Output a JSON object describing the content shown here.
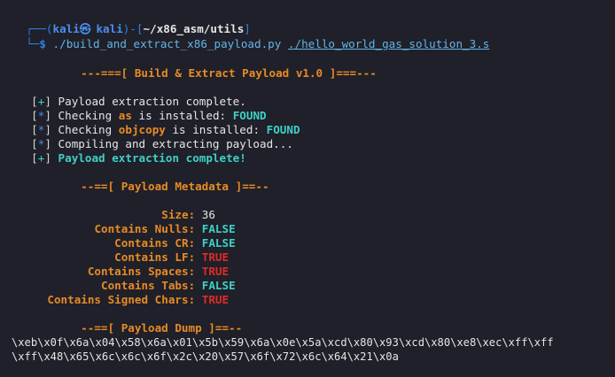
{
  "prompt": {
    "top_prefix": "┌──(",
    "user": "kali",
    "at": "㉿",
    "host": "kali",
    "mid": ")-[",
    "cwd": "~/x86_asm/utils",
    "end": "]",
    "bottom_prefix": "└─",
    "dollar": "$",
    "command": "./build_and_extract_x86_payload.py",
    "argument": "./hello_world_gas_solution_3.s"
  },
  "banner": {
    "left": "---===[",
    "title": "Build & Extract Payload v1.0",
    "right": "]===---"
  },
  "log": [
    {
      "mark": "+",
      "text": "Payload extraction complete."
    },
    {
      "mark": "*",
      "pre": "Checking ",
      "tool": "as",
      "mid": " is installed: ",
      "status": "FOUND"
    },
    {
      "mark": "*",
      "pre": "Checking ",
      "tool": "objcopy",
      "mid": " is installed: ",
      "status": "FOUND"
    },
    {
      "mark": "*",
      "text": "Compiling and extracting payload..."
    },
    {
      "mark": "+",
      "text": "Payload extraction complete!"
    }
  ],
  "metadata": {
    "header_left": "--==[",
    "header_title": "Payload Metadata",
    "header_right": "]==--",
    "rows": [
      {
        "key": "Size:",
        "value": "36",
        "kind": "plain"
      },
      {
        "key": "Contains Nulls:",
        "value": "FALSE",
        "kind": "false"
      },
      {
        "key": "Contains CR:",
        "value": "FALSE",
        "kind": "false"
      },
      {
        "key": "Contains LF:",
        "value": "TRUE",
        "kind": "true"
      },
      {
        "key": "Contains Spaces:",
        "value": "TRUE",
        "kind": "true"
      },
      {
        "key": "Contains Tabs:",
        "value": "FALSE",
        "kind": "false"
      },
      {
        "key": "Contains Signed Chars:",
        "value": "TRUE",
        "kind": "true"
      }
    ]
  },
  "dump": {
    "header_left": "--==[",
    "header_title": "Payload Dump",
    "header_right": "]==--",
    "lines": [
      "\\xeb\\x0f\\x6a\\x04\\x58\\x6a\\x01\\x5b\\x59\\x6a\\x0e\\x5a\\xcd\\x80\\x93\\xcd\\x80\\xe8\\xec\\xff\\xff",
      "\\xff\\x48\\x65\\x6c\\x6c\\x6f\\x2c\\x20\\x57\\x6f\\x72\\x6c\\x64\\x21\\x0a"
    ]
  }
}
